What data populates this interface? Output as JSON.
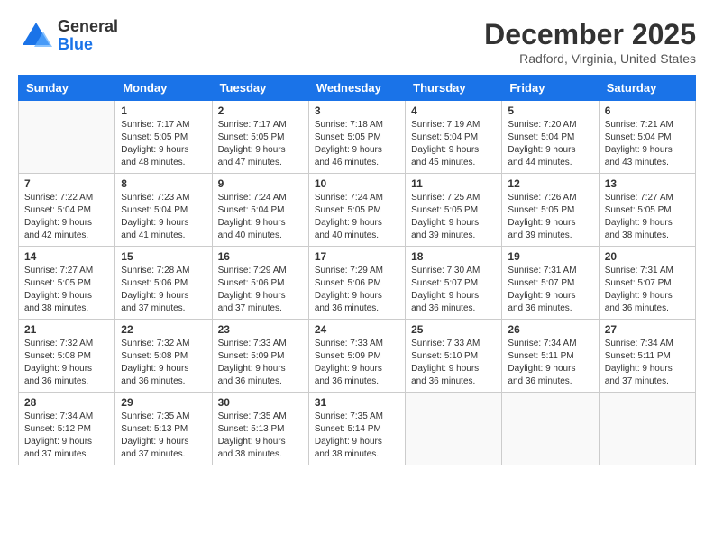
{
  "header": {
    "logo_general": "General",
    "logo_blue": "Blue",
    "month_title": "December 2025",
    "location": "Radford, Virginia, United States"
  },
  "days_of_week": [
    "Sunday",
    "Monday",
    "Tuesday",
    "Wednesday",
    "Thursday",
    "Friday",
    "Saturday"
  ],
  "weeks": [
    [
      {
        "day": "",
        "info": ""
      },
      {
        "day": "1",
        "info": "Sunrise: 7:17 AM\nSunset: 5:05 PM\nDaylight: 9 hours\nand 48 minutes."
      },
      {
        "day": "2",
        "info": "Sunrise: 7:17 AM\nSunset: 5:05 PM\nDaylight: 9 hours\nand 47 minutes."
      },
      {
        "day": "3",
        "info": "Sunrise: 7:18 AM\nSunset: 5:05 PM\nDaylight: 9 hours\nand 46 minutes."
      },
      {
        "day": "4",
        "info": "Sunrise: 7:19 AM\nSunset: 5:04 PM\nDaylight: 9 hours\nand 45 minutes."
      },
      {
        "day": "5",
        "info": "Sunrise: 7:20 AM\nSunset: 5:04 PM\nDaylight: 9 hours\nand 44 minutes."
      },
      {
        "day": "6",
        "info": "Sunrise: 7:21 AM\nSunset: 5:04 PM\nDaylight: 9 hours\nand 43 minutes."
      }
    ],
    [
      {
        "day": "7",
        "info": "Sunrise: 7:22 AM\nSunset: 5:04 PM\nDaylight: 9 hours\nand 42 minutes."
      },
      {
        "day": "8",
        "info": "Sunrise: 7:23 AM\nSunset: 5:04 PM\nDaylight: 9 hours\nand 41 minutes."
      },
      {
        "day": "9",
        "info": "Sunrise: 7:24 AM\nSunset: 5:04 PM\nDaylight: 9 hours\nand 40 minutes."
      },
      {
        "day": "10",
        "info": "Sunrise: 7:24 AM\nSunset: 5:05 PM\nDaylight: 9 hours\nand 40 minutes."
      },
      {
        "day": "11",
        "info": "Sunrise: 7:25 AM\nSunset: 5:05 PM\nDaylight: 9 hours\nand 39 minutes."
      },
      {
        "day": "12",
        "info": "Sunrise: 7:26 AM\nSunset: 5:05 PM\nDaylight: 9 hours\nand 39 minutes."
      },
      {
        "day": "13",
        "info": "Sunrise: 7:27 AM\nSunset: 5:05 PM\nDaylight: 9 hours\nand 38 minutes."
      }
    ],
    [
      {
        "day": "14",
        "info": "Sunrise: 7:27 AM\nSunset: 5:05 PM\nDaylight: 9 hours\nand 38 minutes."
      },
      {
        "day": "15",
        "info": "Sunrise: 7:28 AM\nSunset: 5:06 PM\nDaylight: 9 hours\nand 37 minutes."
      },
      {
        "day": "16",
        "info": "Sunrise: 7:29 AM\nSunset: 5:06 PM\nDaylight: 9 hours\nand 37 minutes."
      },
      {
        "day": "17",
        "info": "Sunrise: 7:29 AM\nSunset: 5:06 PM\nDaylight: 9 hours\nand 36 minutes."
      },
      {
        "day": "18",
        "info": "Sunrise: 7:30 AM\nSunset: 5:07 PM\nDaylight: 9 hours\nand 36 minutes."
      },
      {
        "day": "19",
        "info": "Sunrise: 7:31 AM\nSunset: 5:07 PM\nDaylight: 9 hours\nand 36 minutes."
      },
      {
        "day": "20",
        "info": "Sunrise: 7:31 AM\nSunset: 5:07 PM\nDaylight: 9 hours\nand 36 minutes."
      }
    ],
    [
      {
        "day": "21",
        "info": "Sunrise: 7:32 AM\nSunset: 5:08 PM\nDaylight: 9 hours\nand 36 minutes."
      },
      {
        "day": "22",
        "info": "Sunrise: 7:32 AM\nSunset: 5:08 PM\nDaylight: 9 hours\nand 36 minutes."
      },
      {
        "day": "23",
        "info": "Sunrise: 7:33 AM\nSunset: 5:09 PM\nDaylight: 9 hours\nand 36 minutes."
      },
      {
        "day": "24",
        "info": "Sunrise: 7:33 AM\nSunset: 5:09 PM\nDaylight: 9 hours\nand 36 minutes."
      },
      {
        "day": "25",
        "info": "Sunrise: 7:33 AM\nSunset: 5:10 PM\nDaylight: 9 hours\nand 36 minutes."
      },
      {
        "day": "26",
        "info": "Sunrise: 7:34 AM\nSunset: 5:11 PM\nDaylight: 9 hours\nand 36 minutes."
      },
      {
        "day": "27",
        "info": "Sunrise: 7:34 AM\nSunset: 5:11 PM\nDaylight: 9 hours\nand 37 minutes."
      }
    ],
    [
      {
        "day": "28",
        "info": "Sunrise: 7:34 AM\nSunset: 5:12 PM\nDaylight: 9 hours\nand 37 minutes."
      },
      {
        "day": "29",
        "info": "Sunrise: 7:35 AM\nSunset: 5:13 PM\nDaylight: 9 hours\nand 37 minutes."
      },
      {
        "day": "30",
        "info": "Sunrise: 7:35 AM\nSunset: 5:13 PM\nDaylight: 9 hours\nand 38 minutes."
      },
      {
        "day": "31",
        "info": "Sunrise: 7:35 AM\nSunset: 5:14 PM\nDaylight: 9 hours\nand 38 minutes."
      },
      {
        "day": "",
        "info": ""
      },
      {
        "day": "",
        "info": ""
      },
      {
        "day": "",
        "info": ""
      }
    ]
  ]
}
